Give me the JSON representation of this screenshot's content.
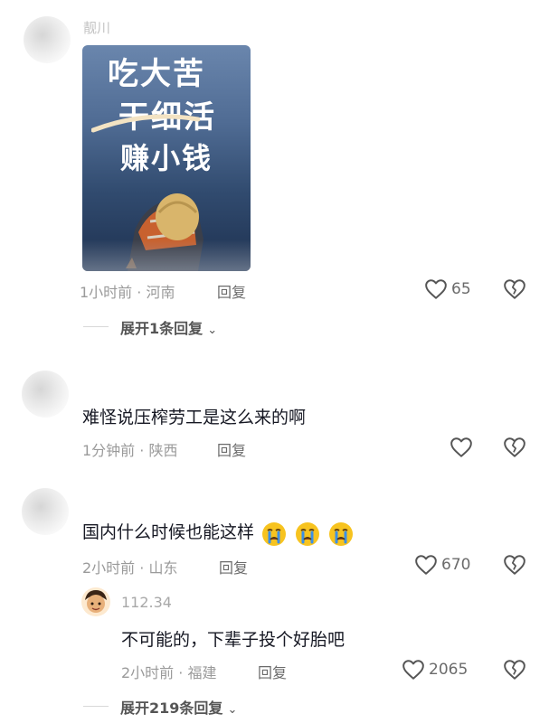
{
  "comments": [
    {
      "username": "靓川",
      "image_lines": [
        "吃大苦",
        "干细活",
        "赚小钱"
      ],
      "time_location": "1小时前 · 河南",
      "reply_label": "回复",
      "likes": "65",
      "expand_label": "展开1条回复"
    },
    {
      "text": "难怪说压榨劳工是这么来的啊",
      "time_location": "1分钟前 · 陕西",
      "reply_label": "回复"
    },
    {
      "text": "国内什么时候也能这样",
      "emojis": [
        "crying-face",
        "crying-face",
        "crying-face"
      ],
      "time_location": "2小时前 · 山东",
      "reply_label": "回复",
      "likes": "670",
      "replies": [
        {
          "username": "112.34",
          "text": "不可能的，下辈子投个好胎吧",
          "time_location": "2小时前 · 福建",
          "reply_label": "回复",
          "likes": "2065"
        }
      ],
      "expand_label": "展开219条回复"
    }
  ],
  "colors": {
    "accent": "#161823",
    "meta": "#9a9a9a",
    "emoji": "#f7c31f"
  }
}
